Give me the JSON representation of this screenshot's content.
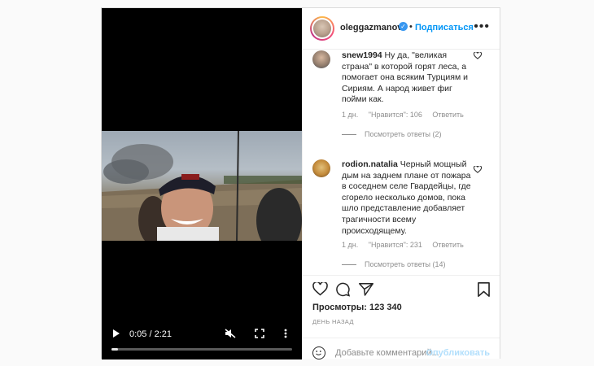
{
  "header": {
    "username": "oleggazmanov",
    "subscribe_label": "Подписаться",
    "more_label": "•••"
  },
  "video": {
    "time_label": "0:05 / 2:21",
    "progress": 0.035
  },
  "comments": [
    {
      "user": "snew1994",
      "text": "Ну да, \"великая страна\" в которой горят леса, а помогает она всяким Турциям и Сириям. А народ живет фиг пойми как.",
      "age": "1 дн.",
      "likes": "\"Нравится\": 106",
      "reply": "Ответить",
      "view_replies": "Посмотреть ответы (2)"
    },
    {
      "user": "rodion.natalia",
      "text": "Черный мощный дым на заднем плане от пожара в соседнем селе Гвардейцы, где сгорело несколько домов, пока шло представление добавляет трагичности всему происходящему.",
      "age": "1 дн.",
      "likes": "\"Нравится\": 231",
      "reply": "Ответить",
      "view_replies": "Посмотреть ответы (14)"
    }
  ],
  "stats": {
    "views": "Просмотры: 123 340",
    "time_ago": "ДЕНЬ НАЗАД"
  },
  "add_comment": {
    "placeholder": "Добавьте комментарий...",
    "publish_label": "Опубликовать"
  },
  "colors": {
    "accent": "#0095f6",
    "verified": "#3897f0"
  }
}
